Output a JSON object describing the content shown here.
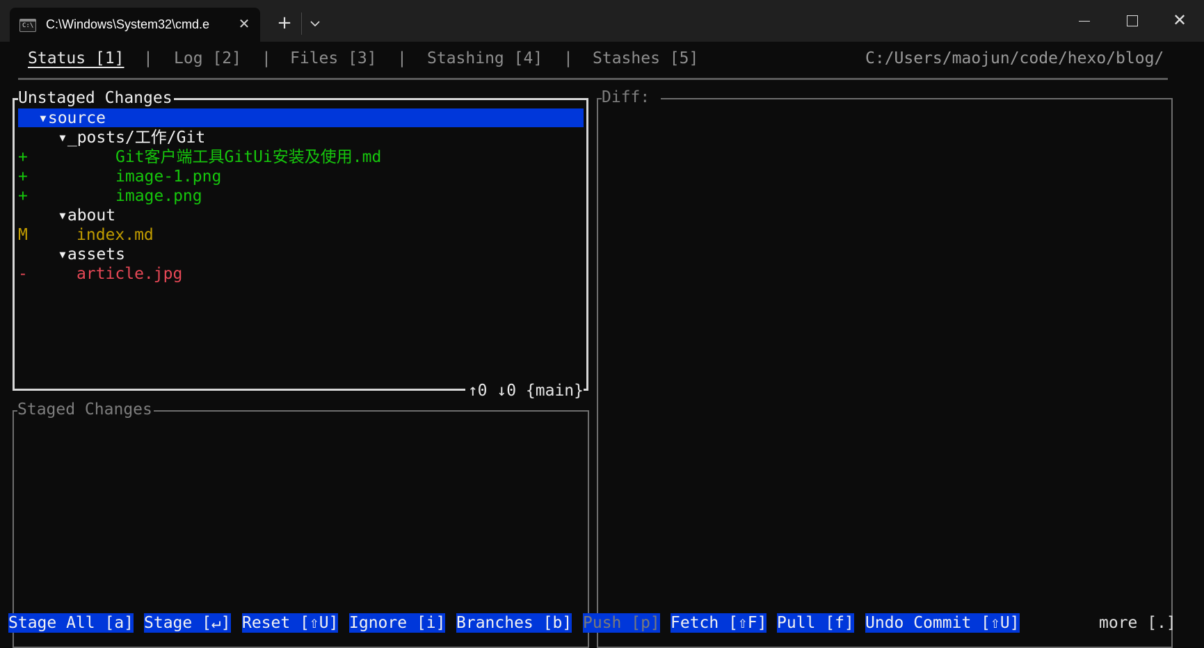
{
  "window": {
    "tab_title": "C:\\Windows\\System32\\cmd.e",
    "new_tab": "+",
    "tab_close": "✕",
    "close": "✕"
  },
  "menu": {
    "items": [
      {
        "label": "Status [1]",
        "active": true
      },
      {
        "label": "Log [2]"
      },
      {
        "label": "Files [3]"
      },
      {
        "label": "Stashing [4]"
      },
      {
        "label": "Stashes [5]"
      }
    ],
    "separator": "|",
    "repo_path": "C:/Users/maojun/code/hexo/blog/"
  },
  "unstaged": {
    "title": "Unstaged Changes",
    "footer": "↑0 ↓0 {main}",
    "rows": [
      {
        "status": "",
        "text": "▾source",
        "color": "#f2f2f2"
      },
      {
        "status": "",
        "text": "▾_posts/工作/Git",
        "color": "#f2f2f2"
      },
      {
        "status": "+",
        "text": "Git客户端工具GitUi安装及使用.md",
        "color": "#16c60c"
      },
      {
        "status": "+",
        "text": "image-1.png",
        "color": "#16c60c"
      },
      {
        "status": "+",
        "text": "image.png",
        "color": "#16c60c"
      },
      {
        "status": "",
        "text": "▾about",
        "color": "#f2f2f2"
      },
      {
        "status": "M",
        "text": "index.md",
        "color": "#c19c00"
      },
      {
        "status": "",
        "text": "▾assets",
        "color": "#f2f2f2"
      },
      {
        "status": "-",
        "text": "article.jpg",
        "color": "#e74856"
      }
    ]
  },
  "staged": {
    "title": "Staged Changes"
  },
  "diff": {
    "title": "Diff: "
  },
  "commands": [
    {
      "label": "Stage All [a]"
    },
    {
      "label": "Stage [↵]"
    },
    {
      "label": "Reset [⇧U]"
    },
    {
      "label": "Ignore [i]"
    },
    {
      "label": "Branches [b]"
    },
    {
      "label": "Push [p]",
      "disabled": true
    },
    {
      "label": "Fetch [⇧F]"
    },
    {
      "label": "Pull [f]"
    },
    {
      "label": "Undo Commit [⇧U]"
    }
  ],
  "more": "more [.]"
}
